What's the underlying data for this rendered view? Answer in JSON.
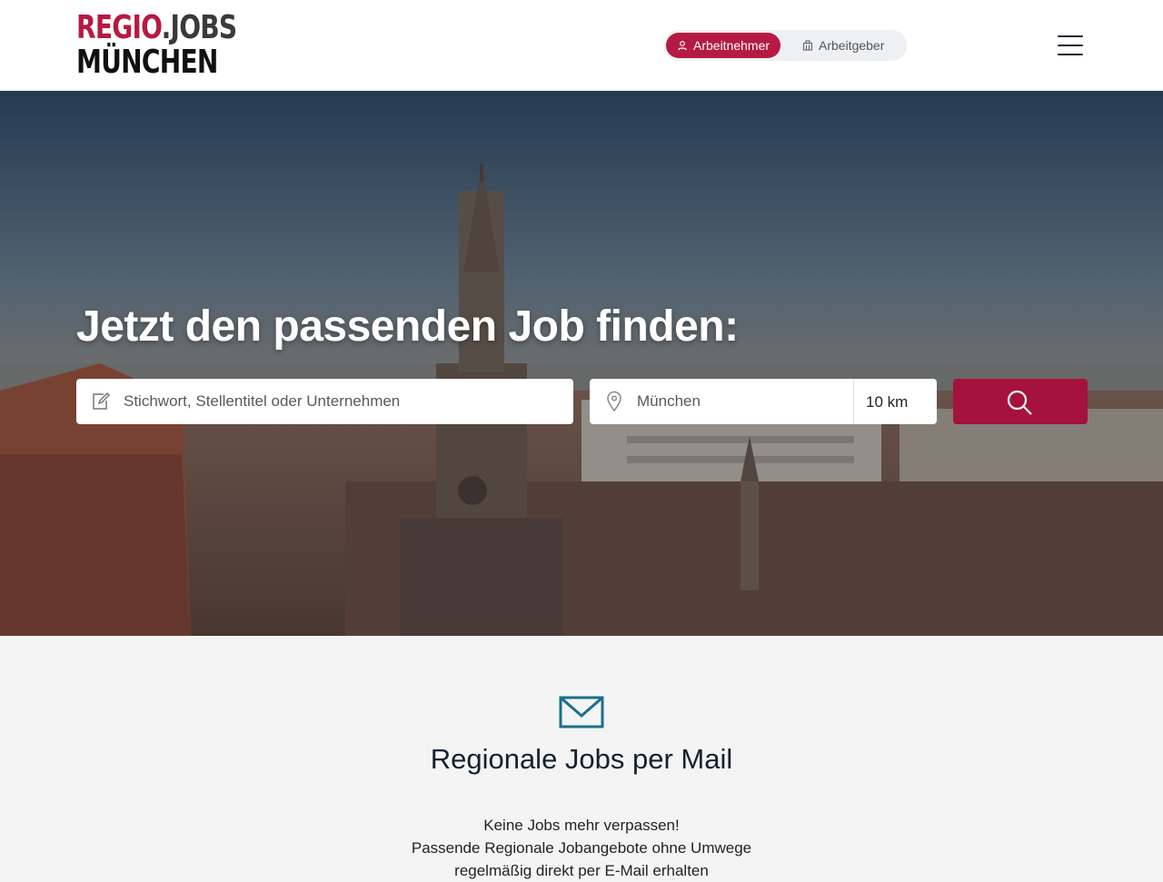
{
  "header": {
    "logo": {
      "part1": "REGIO",
      "part2": ".JOBS",
      "city": "MÜNCHEN"
    },
    "toggle": {
      "employee_label": "Arbeitnehmer",
      "employer_label": "Arbeitgeber",
      "selected": "Arbeitnehmer"
    },
    "menu_icon": "hamburger-icon"
  },
  "hero": {
    "title": "Jetzt den passenden Job finden:",
    "keyword_placeholder": "Stichwort, Stellentitel oder Unternehmen",
    "location_placeholder": "München",
    "radius_value": "10 km",
    "keyword_icon": "edit-icon",
    "location_icon": "map-pin-icon",
    "search_icon": "search-icon"
  },
  "mail_section": {
    "icon": "envelope-icon",
    "title": "Regionale Jobs per Mail",
    "line1": "Keine Jobs mehr verpassen!",
    "line2": "Passende Regionale Jobangebote ohne Umwege",
    "line3": "regelmäßig direkt per E-Mail erhalten"
  },
  "colors": {
    "brand": "#b51a44",
    "search_button": "#a5123d",
    "mail_icon": "#1a6f8c"
  }
}
